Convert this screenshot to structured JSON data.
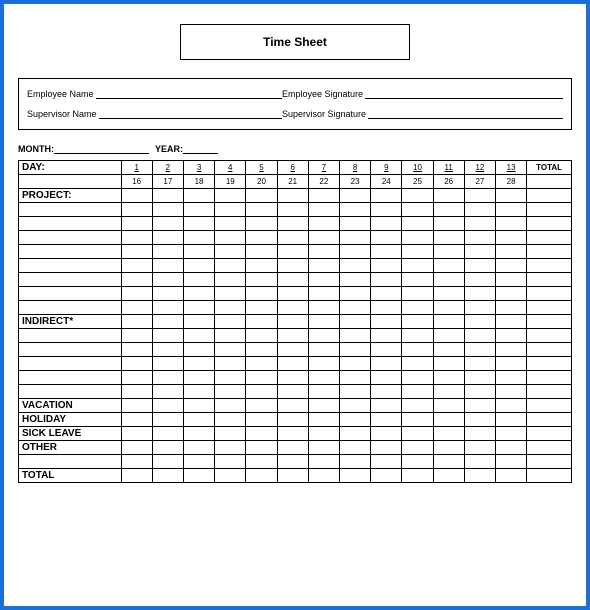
{
  "title": "Time Sheet",
  "signatures": {
    "emp_name_label": "Employee Name",
    "emp_sig_label": "Employee Signature",
    "sup_name_label": "Supervisor Name",
    "sup_sig_label": "Supervisor Signature"
  },
  "period": {
    "month_label": "MONTH:",
    "year_label": "YEAR:"
  },
  "grid": {
    "day_label": "DAY:",
    "total_label": "TOTAL",
    "days_row1": [
      "1",
      "2",
      "3",
      "4",
      "5",
      "6",
      "7",
      "8",
      "9",
      "10",
      "11",
      "12",
      "13"
    ],
    "days_row2": [
      "16",
      "17",
      "18",
      "19",
      "20",
      "21",
      "22",
      "23",
      "24",
      "25",
      "26",
      "27",
      "28"
    ],
    "section_project": "PROJECT:",
    "section_indirect": "INDIRECT*",
    "row_vacation": "VACATION",
    "row_holiday": "HOLIDAY",
    "row_sick": "SICK LEAVE",
    "row_other": "OTHER",
    "row_total": "TOTAL"
  }
}
